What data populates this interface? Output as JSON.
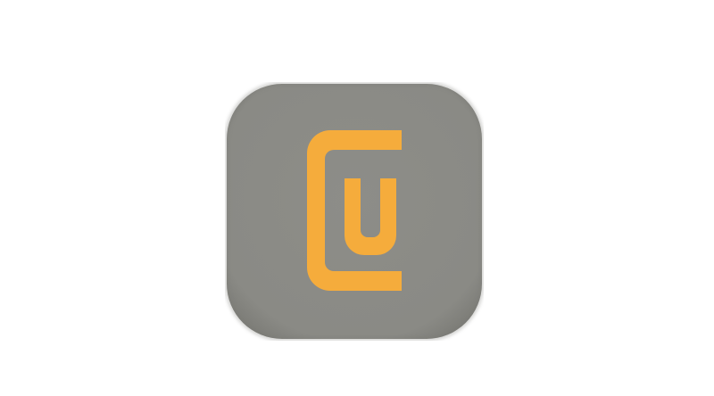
{
  "app_icon": {
    "icon": "cu-app-icon",
    "lettering": "CU",
    "colors": {
      "tile": "#8b8b86",
      "tile_edge": "#7e7e79",
      "glyph": "#f5ac3c"
    }
  }
}
